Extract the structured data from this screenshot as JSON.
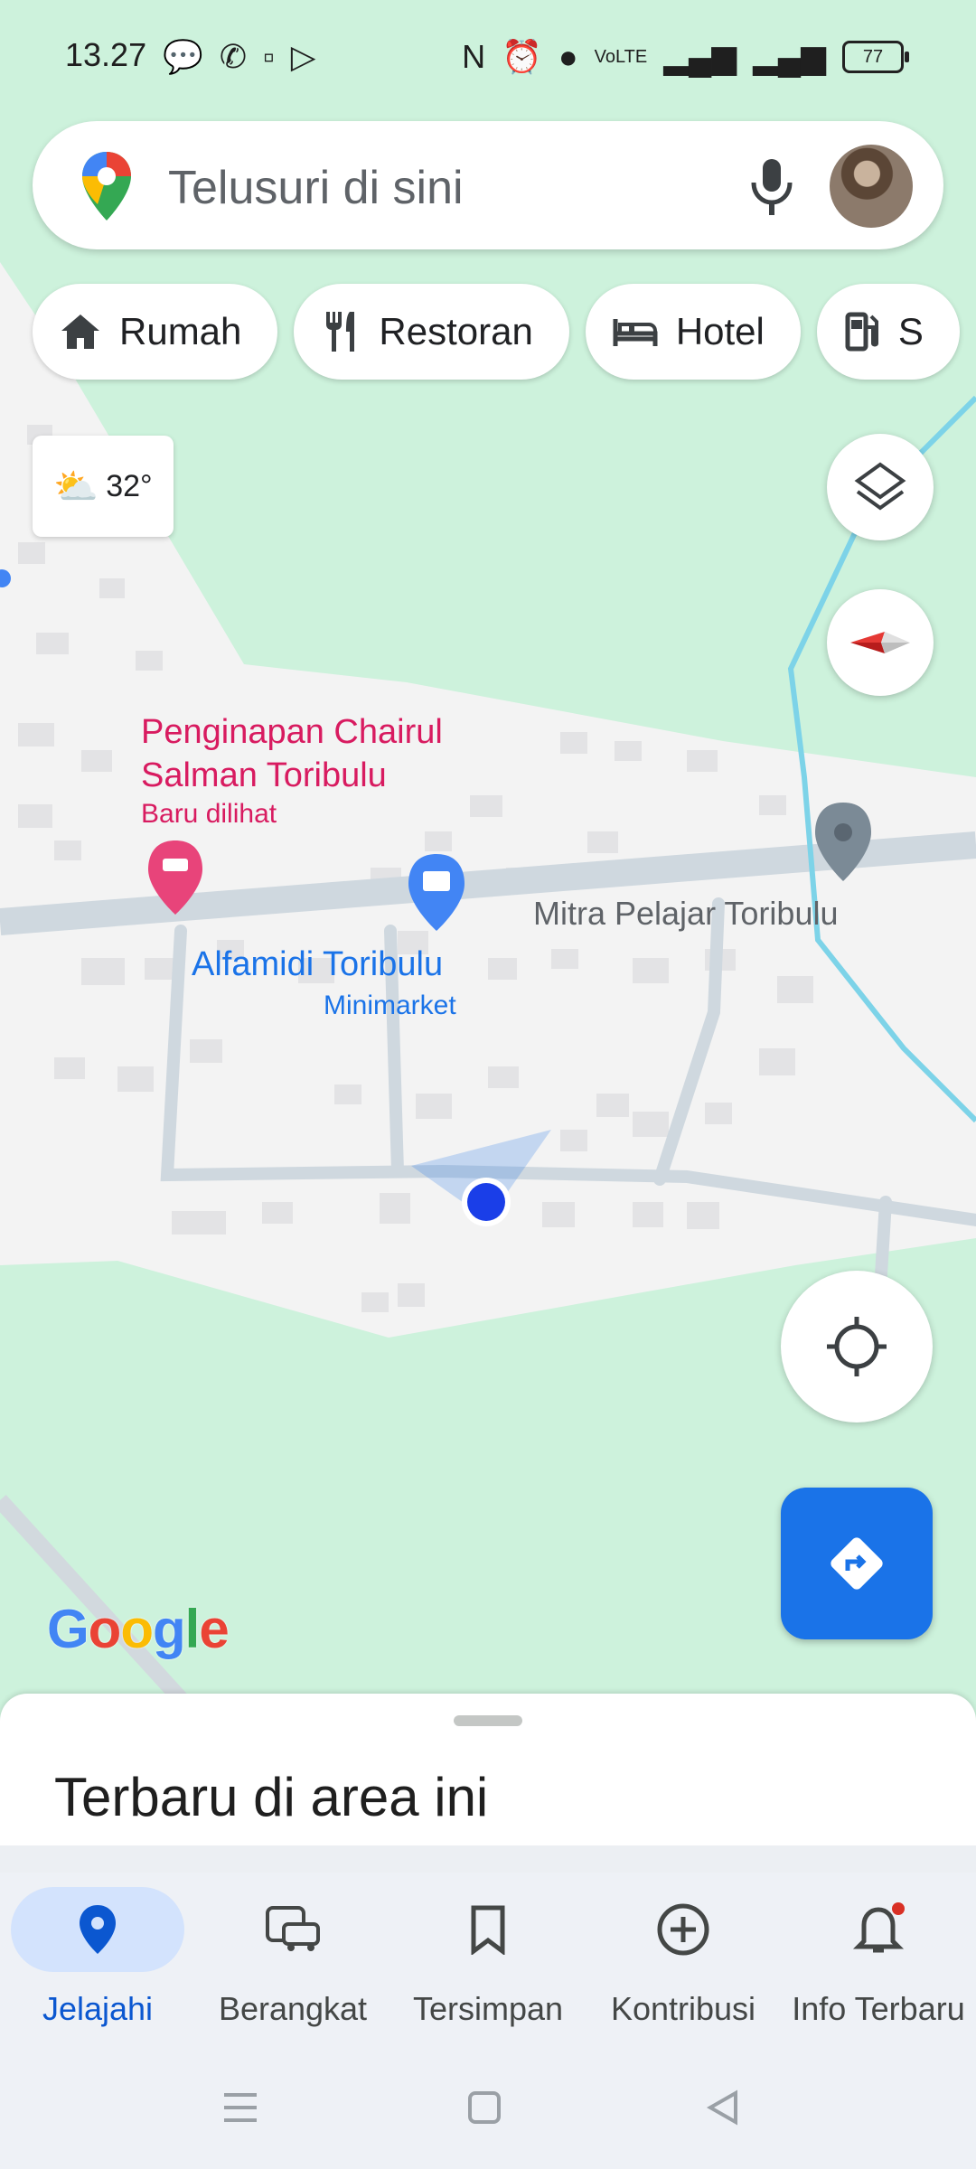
{
  "status_bar": {
    "time": "13.27",
    "battery": "77"
  },
  "search": {
    "placeholder": "Telusuri di sini"
  },
  "chips": [
    "Rumah",
    "Restoran",
    "Hotel",
    "S"
  ],
  "weather": {
    "temp": "32°"
  },
  "map_labels": {
    "hotel_name": "Penginapan Chairul Salman Toribulu",
    "hotel_sub": "Baru dilihat",
    "store_name": "Alfamidi Toribulu",
    "store_type": "Minimarket",
    "place3": "Mitra Pelajar Toribulu"
  },
  "logo": "Google",
  "bottom_sheet": {
    "title": "Terbaru di area ini"
  },
  "nav": [
    "Jelajahi",
    "Berangkat",
    "Tersimpan",
    "Kontribusi",
    "Info Terbaru"
  ],
  "colors": {
    "accent": "#1a73e8",
    "map_green": "#cdf2dc",
    "hotel_pin": "#e8447a"
  }
}
